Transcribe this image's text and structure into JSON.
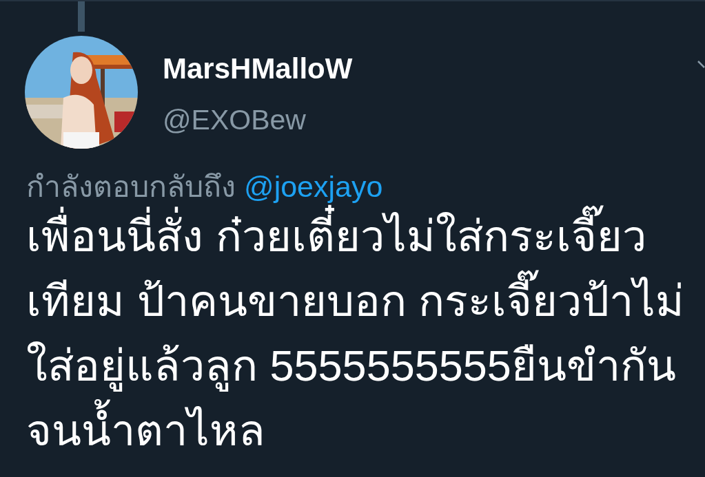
{
  "tweet": {
    "author": {
      "name": "MarsHMalloW",
      "handle": "@EXOBew"
    },
    "reply_to": {
      "label": "กำลังตอบกลับถึง",
      "handle": "@joexjayo"
    },
    "text": "เพื่อนนี่สั่ง ก๋วยเตี๋ยวไม่ใส่กระเจี๊ยว\nเทียม ป้าคนขายบอก กระเจี๊ยวป้าไม่\nใส่อยู่แล้วลูก 5555555555ยืนขำกัน\nจนน้ำตาไหล"
  }
}
